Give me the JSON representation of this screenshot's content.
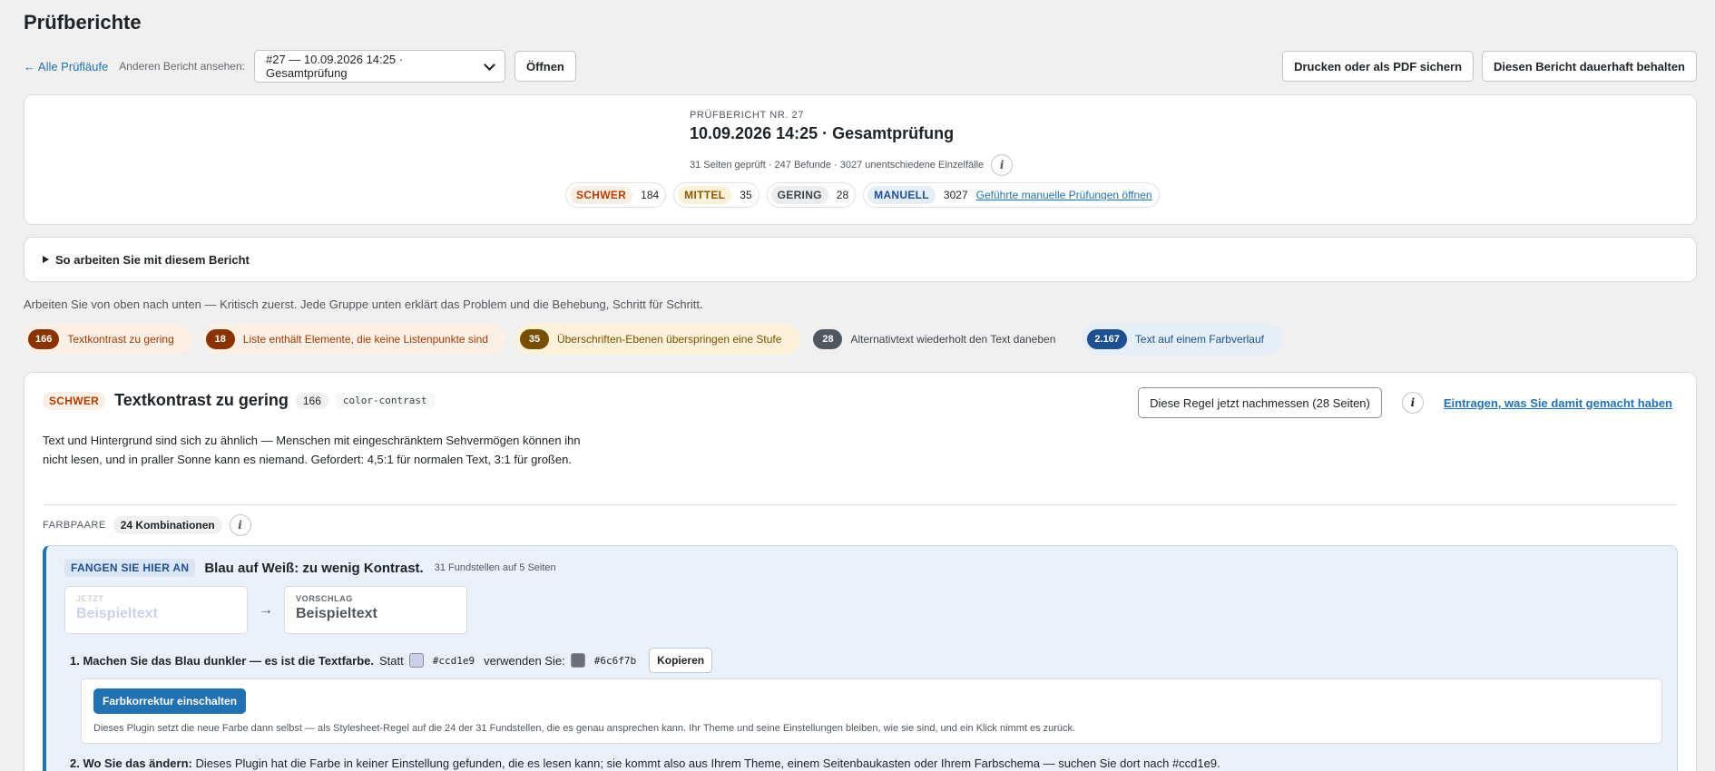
{
  "page": {
    "title": "Prüfberichte"
  },
  "toolbar": {
    "back_link": "← Alle Prüfläufe",
    "select_label": "Anderen Bericht ansehen:",
    "select_value": "#27 — 10.09.2026 14:25 · Gesamtprüfung",
    "open_button": "Öffnen",
    "print_button": "Drucken oder als PDF sichern",
    "keep_button": "Diesen Bericht dauerhaft behalten"
  },
  "summary": {
    "eyebrow": "PRÜFBERICHT NR. 27",
    "title": "10.09.2026 14:25 · Gesamtprüfung",
    "meta": "31 Seiten geprüft · 247 Befunde · 3027 unentschiedene Einzelfälle",
    "info_icon": "i",
    "severities": [
      {
        "label": "SCHWER",
        "count": "184"
      },
      {
        "label": "MITTEL",
        "count": "35"
      },
      {
        "label": "GERING",
        "count": "28"
      },
      {
        "label": "MANUELL",
        "count": "3027",
        "link": "Geführte manuelle Prüfungen öffnen"
      }
    ]
  },
  "howto": {
    "label": "So arbeiten Sie mit diesem Bericht"
  },
  "intro": "Arbeiten Sie von oben nach unten — Kritisch zuerst. Jede Gruppe unten erklärt das Problem und die Behebung, Schritt für Schritt.",
  "groups": [
    {
      "count": "166",
      "label": "Textkontrast zu gering"
    },
    {
      "count": "18",
      "label": "Liste enthält Elemente, die keine Listenpunkte sind"
    },
    {
      "count": "35",
      "label": "Überschriften-Ebenen überspringen eine Stufe"
    },
    {
      "count": "28",
      "label": "Alternativtext wiederholt den Text daneben"
    },
    {
      "count": "2.167",
      "label": "Text auf einem Farbverlauf"
    }
  ],
  "rule": {
    "severity": "SCHWER",
    "title": "Textkontrast zu gering",
    "count": "166",
    "code": "color-contrast",
    "remeasure_button": "Diese Regel jetzt nachmessen (28 Seiten)",
    "info_icon": "i",
    "log_link": "Eintragen, was Sie damit gemacht haben",
    "description": "Text und Hintergrund sind sich zu ähnlich — Menschen mit eingeschränktem Sehvermögen können ihn nicht lesen, und in praller Sonne kann es niemand. Gefordert: 4,5:1 für normalen Text, 3:1 für großen.",
    "pairs_label": "FARBPAARE",
    "pairs_count": "24 Kombinationen",
    "start": {
      "tag": "FANGEN SIE HIER AN",
      "title": "Blau auf Weiß: zu wenig Kontrast.",
      "meta": "31 Fundstellen auf 5 Seiten",
      "now_label": "JETZT",
      "now_text": "Beispieltext",
      "arrow": "→",
      "suggest_label": "VORSCHLAG",
      "suggest_text": "Beispieltext",
      "step1_bold": "1. Machen Sie das Blau dunkler — es ist die Textfarbe.",
      "step1_instead": "Statt",
      "old_color": "#ccd1e9",
      "step1_use": "verwenden Sie:",
      "new_color": "#6c6f7b",
      "copy_button": "Kopieren",
      "fix_button": "Farbkorrektur einschalten",
      "fix_note": "Dieses Plugin setzt die neue Farbe dann selbst — als Stylesheet-Regel auf die 24 der 31 Fundstellen, die es genau ansprechen kann. Ihr Theme und seine Einstellungen bleiben, wie sie sind, und ein Klick nimmt es zurück.",
      "step2_bold": "2. Wo Sie das ändern:",
      "step2_text": "Dieses Plugin hat die Farbe in keiner Einstellung gefunden, die es lesen kann; sie kommt also aus Ihrem Theme, einem Seitenbaukasten oder Ihrem Farbschema — suchen Sie dort nach #ccd1e9."
    }
  },
  "colors": {
    "accent": "#2271b1",
    "old_swatch": "#ccd1e9",
    "new_swatch": "#6c6f7b"
  }
}
